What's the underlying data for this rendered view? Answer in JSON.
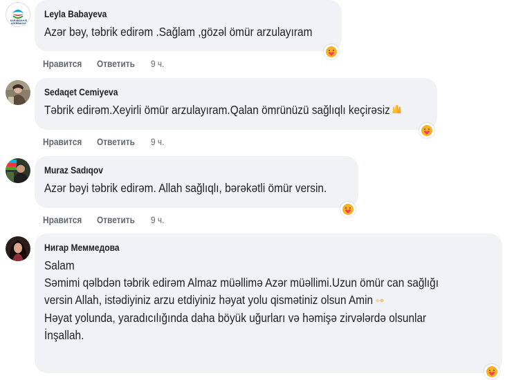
{
  "comments": [
    {
      "author": "Leyla Babayeva",
      "avatar": "karabakh-logo-avatar",
      "avatar_caption": "KARABAKH İS AZERBAIJAN",
      "lines": [
        "Azər bəy, təbrik edirəm .Sağlam ,gözəl ömür arzulayıram"
      ],
      "like_label": "Нравится",
      "reply_label": "Ответить",
      "time": "9 ч.",
      "reaction": "care-reaction-icon"
    },
    {
      "author": "Sedaqet Cemiyeva",
      "avatar": "user-photo-avatar",
      "lines": [
        "Təbrik edirəm.Xeyirli ömür arzulayıram.Qalan ömrünüzü sağlıqlı keçirəsiz"
      ],
      "inline_emoji": "raised-hands-icon",
      "like_label": "Нравится",
      "reply_label": "Ответить",
      "time": "9 ч.",
      "reaction": "care-reaction-icon"
    },
    {
      "author": "Muraz Sadıqov",
      "avatar": "flag-photo-avatar",
      "lines": [
        "Azər bəyi təbrik edirəm. Allah sağlıqlı, bərəkətli ömür versin."
      ],
      "like_label": "Нравится",
      "reply_label": "Ответить",
      "time": "9 ч.",
      "reaction": "care-reaction-icon"
    },
    {
      "author": "Нигар Меммедова",
      "avatar": "user-portrait-avatar",
      "lines": [
        "Salam",
        "Səmimi qəlbdən təbrik edirəm Almaz müəllimə Azər müəllimi.Uzun ömür can sağlığı",
        "versin Allah, istədiyiniz arzu etdiyiniz həyat yolu qismətiniz olsun Amin",
        "Həyat yolunda, yaradıcılığında daha böyük uğurları və həmişə zirvələrdə olsunlar",
        "İnşallah."
      ],
      "inline_emoji": "praying-hands-icon",
      "reaction": "care-reaction-icon"
    }
  ],
  "colors": {
    "bubble": "#f0f2f5",
    "text": "#1c1e21",
    "meta": "#606770",
    "care_yellow": "#f7b125",
    "care_heart": "#f33e58"
  }
}
